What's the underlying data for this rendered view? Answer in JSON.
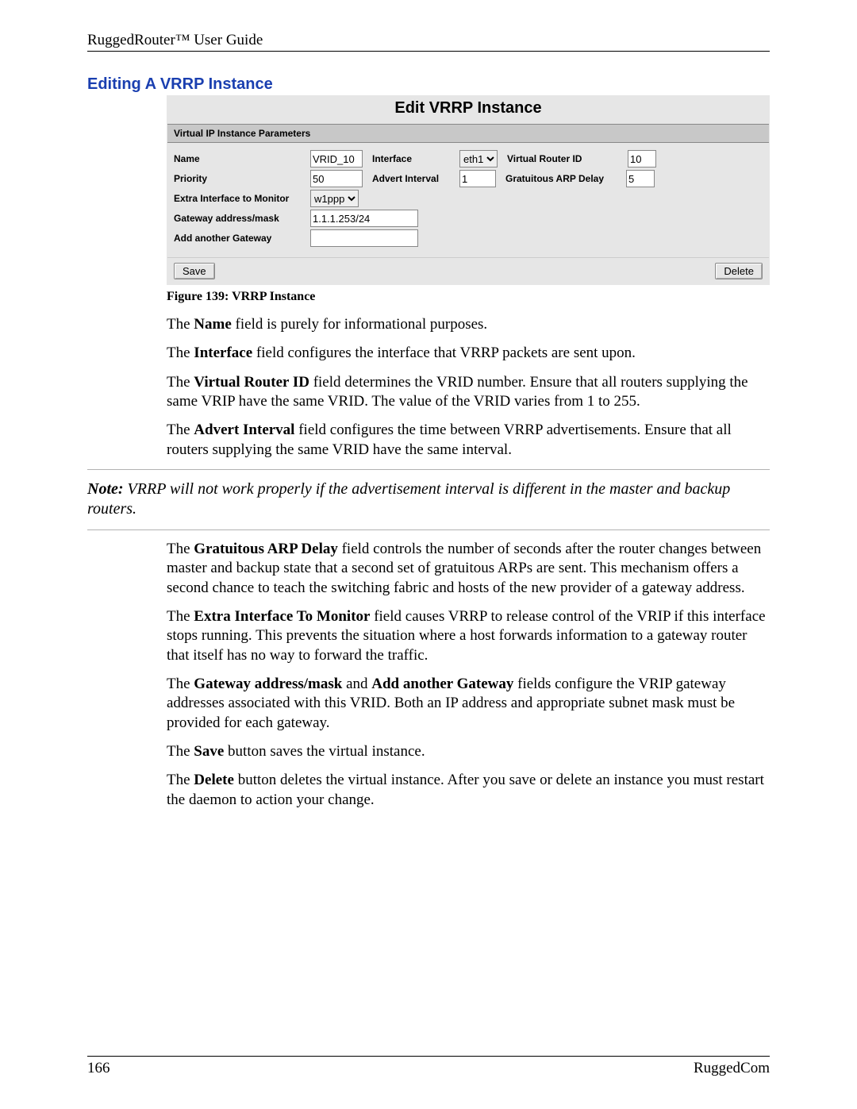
{
  "header": {
    "doc_title": "RuggedRouter™ User Guide"
  },
  "section": {
    "title": "Editing A VRRP Instance"
  },
  "screenshot": {
    "title": "Edit VRRP Instance",
    "group_header": "Virtual IP Instance Parameters",
    "labels": {
      "name": "Name",
      "interface": "Interface",
      "virtual_router_id": "Virtual Router ID",
      "priority": "Priority",
      "advert_interval": "Advert Interval",
      "gratuitous_arp_delay": "Gratuitous ARP Delay",
      "extra_if": "Extra Interface to Monitor",
      "gateway": "Gateway address/mask",
      "add_gateway": "Add another Gateway"
    },
    "values": {
      "name": "VRID_10",
      "interface": "eth1",
      "virtual_router_id": "10",
      "priority": "50",
      "advert_interval": "1",
      "gratuitous_arp_delay": "5",
      "extra_if": "w1ppp",
      "gateway": "1.1.1.253/24",
      "add_gateway": ""
    },
    "buttons": {
      "save": "Save",
      "delete": "Delete"
    }
  },
  "figure": {
    "caption": "Figure 139: VRRP Instance"
  },
  "paragraphs": {
    "p1a": "The ",
    "p1b": "Name",
    "p1c": " field is purely for informational purposes.",
    "p2a": "The ",
    "p2b": "Interface",
    "p2c": " field configures the interface that VRRP packets are sent upon.",
    "p3a": "The ",
    "p3b": "Virtual Router ID",
    "p3c": " field determines the VRID number.  Ensure that all routers supplying the same VRIP have the same VRID. The value of the VRID varies from 1 to 255.",
    "p4a": "The ",
    "p4b": "Advert Interval",
    "p4c": " field configures the time between VRRP advertisements.  Ensure that all routers supplying the same VRID have the same interval.",
    "note_b": "Note:",
    "note_rest": "  VRRP will not work properly if the advertisement interval is different in the master and backup routers.",
    "p5a": "The ",
    "p5b": "Gratuitous ARP Delay",
    "p5c": " field controls the number of seconds after the router changes between master and backup state that a second set of gratuitous ARPs are sent.  This mechanism offers a second chance to teach the switching fabric and hosts of the new  provider of a gateway address.",
    "p6a": "The ",
    "p6b": "Extra Interface To Monitor",
    "p6c": " field causes VRRP to release control of the VRIP if this interface stops running.  This prevents the situation where a host forwards information to a gateway router that itself has no way to forward the traffic.",
    "p7a": "The ",
    "p7b": "Gateway address/mask",
    "p7c": " and ",
    "p7d": "Add another Gateway",
    "p7e": " fields configure the VRIP gateway addresses associated with this VRID.  Both an IP address and appropriate subnet mask must be provided for each gateway.",
    "p8a": "The ",
    "p8b": "Save",
    "p8c": " button saves the virtual instance.",
    "p9a": "The ",
    "p9b": "Delete",
    "p9c": " button deletes the virtual instance.  After you save or delete an instance you must restart the daemon to action your change."
  },
  "footer": {
    "page_number": "166",
    "company": "RuggedCom"
  }
}
